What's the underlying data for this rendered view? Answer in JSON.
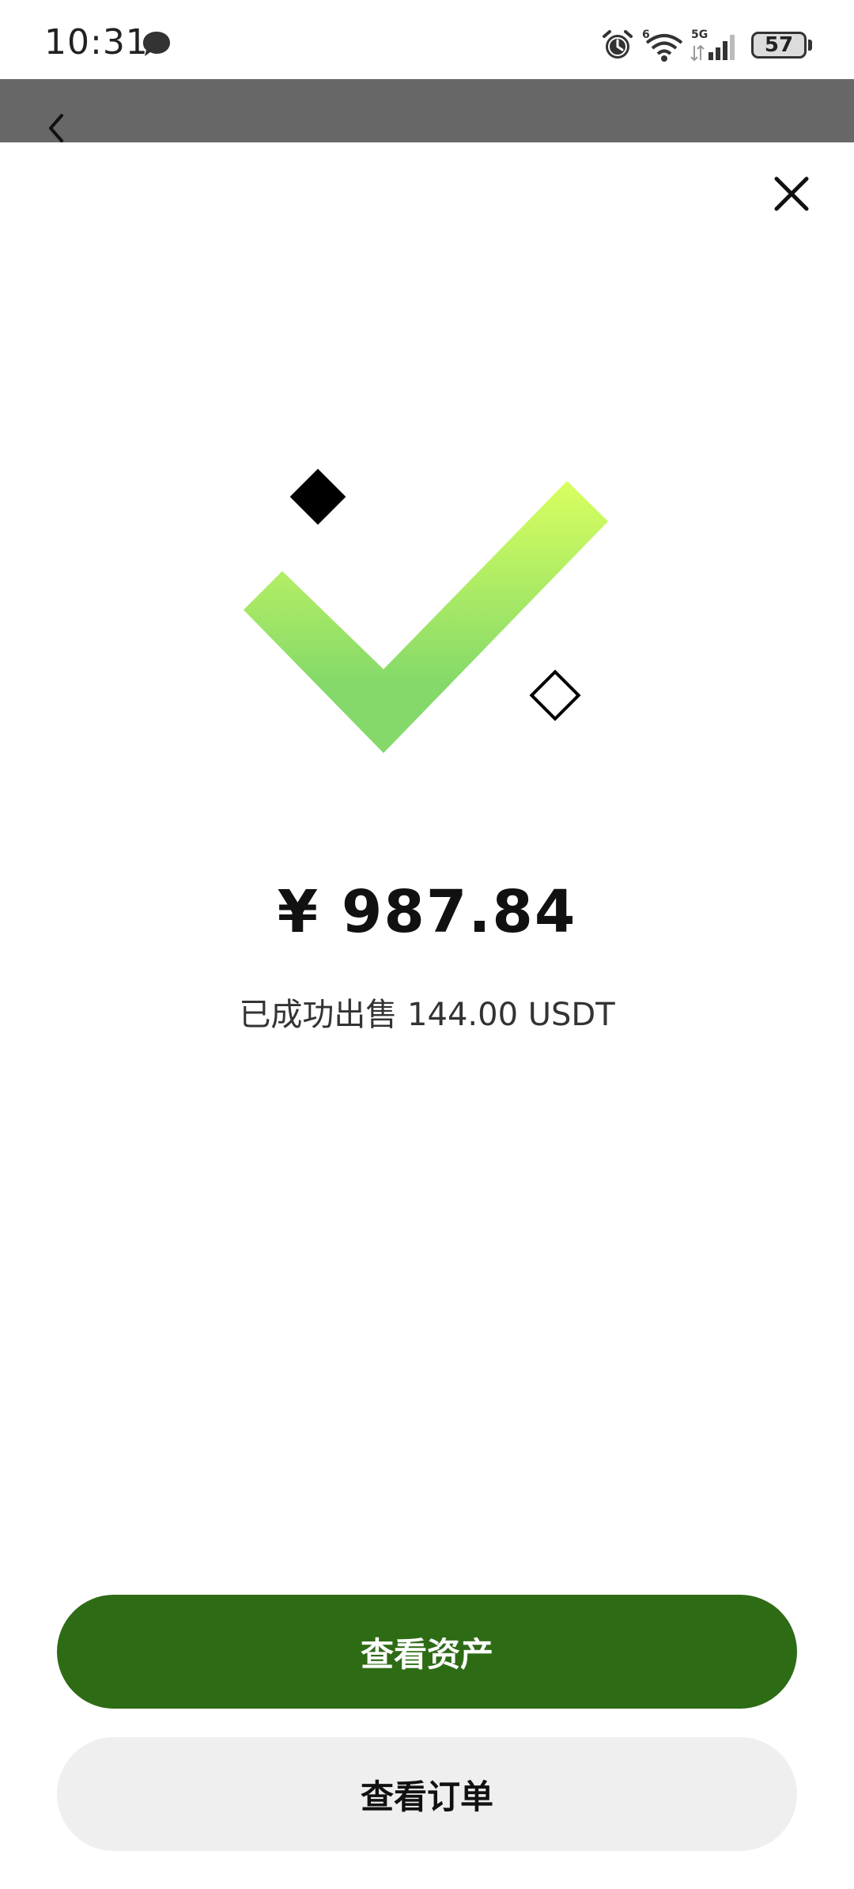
{
  "status_bar": {
    "time": "10:31",
    "battery": "57",
    "network": "5G",
    "wifi_badge": "6",
    "icons": [
      "message-icon",
      "alarm-icon",
      "wifi-icon",
      "signal-icon",
      "battery-icon"
    ]
  },
  "header": {
    "back_icon": "chevron-left-icon"
  },
  "result": {
    "close_icon": "close-icon",
    "status_icon": "check-icon",
    "amount": "¥ 987.84",
    "message": "已成功出售 144.00 USDT"
  },
  "actions": {
    "view_assets": "查看资产",
    "view_orders": "查看订单"
  },
  "colors": {
    "primary_button": "#2e6b15",
    "secondary_button": "#efefef",
    "check_gradient_top": "#d9ff5f",
    "check_gradient_bottom": "#84d96a",
    "header_overlay": "#676767"
  }
}
